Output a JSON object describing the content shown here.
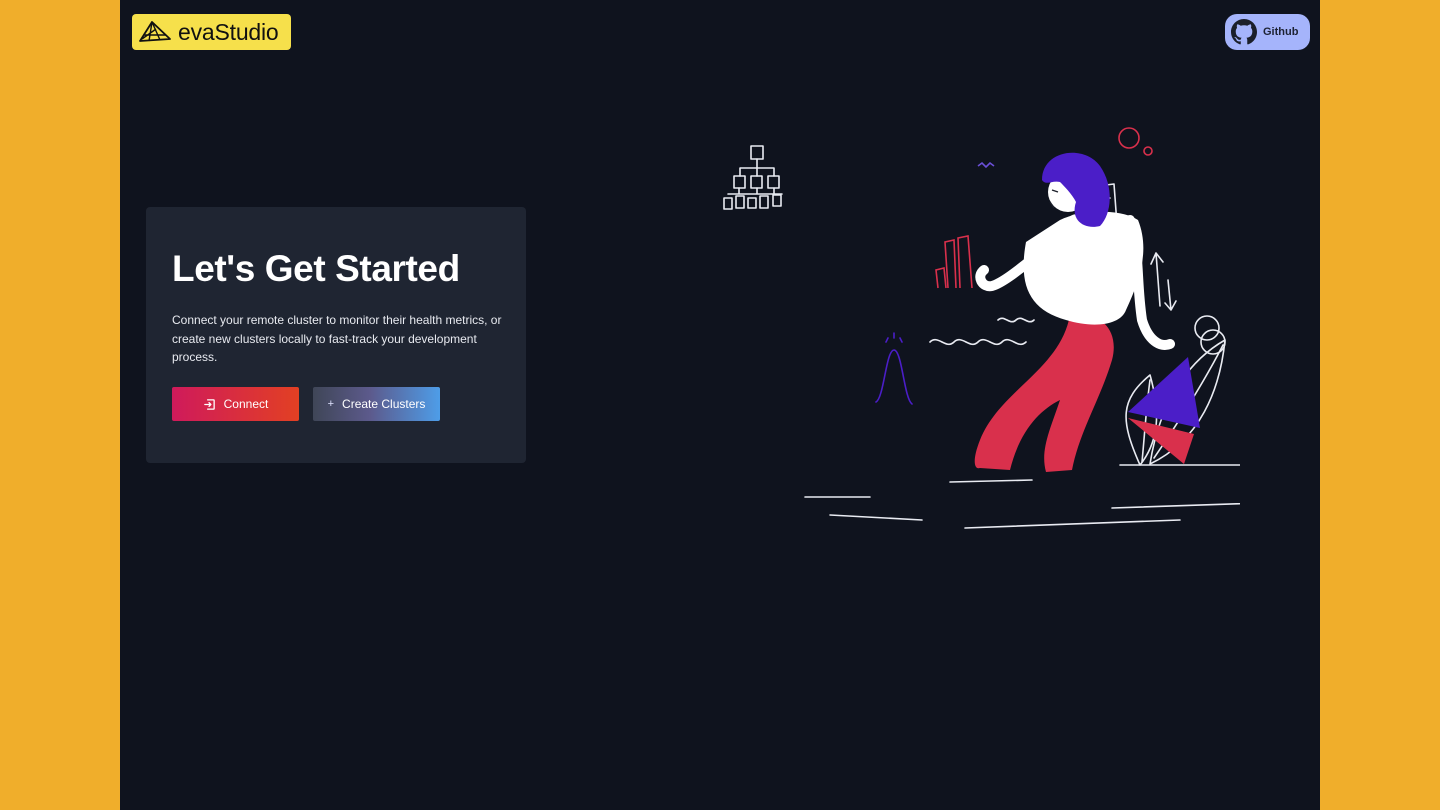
{
  "brand": {
    "name": "evaStudio",
    "logo_icon": "tent-logo-icon",
    "bg": "#f6e04b"
  },
  "header": {
    "github_label": "Github",
    "github_icon": "github-icon"
  },
  "hero": {
    "title": "Let's Get Started",
    "description": "Connect your remote cluster to monitor their health metrics, or create new clusters locally to fast-track your development process."
  },
  "actions": {
    "connect_label": "Connect",
    "connect_icon": "login-icon",
    "create_label": "Create Clusters",
    "create_icon": "plus-icon"
  },
  "colors": {
    "page_bg": "#f0ae2b",
    "app_bg": "#0f131e",
    "card_bg": "#1f2532",
    "accent_red": "#d9304c",
    "accent_purple": "#4b1ec8",
    "github_bg": "#a5b4fb"
  },
  "illustration": {
    "icon": "woman-with-charts-illustration"
  }
}
